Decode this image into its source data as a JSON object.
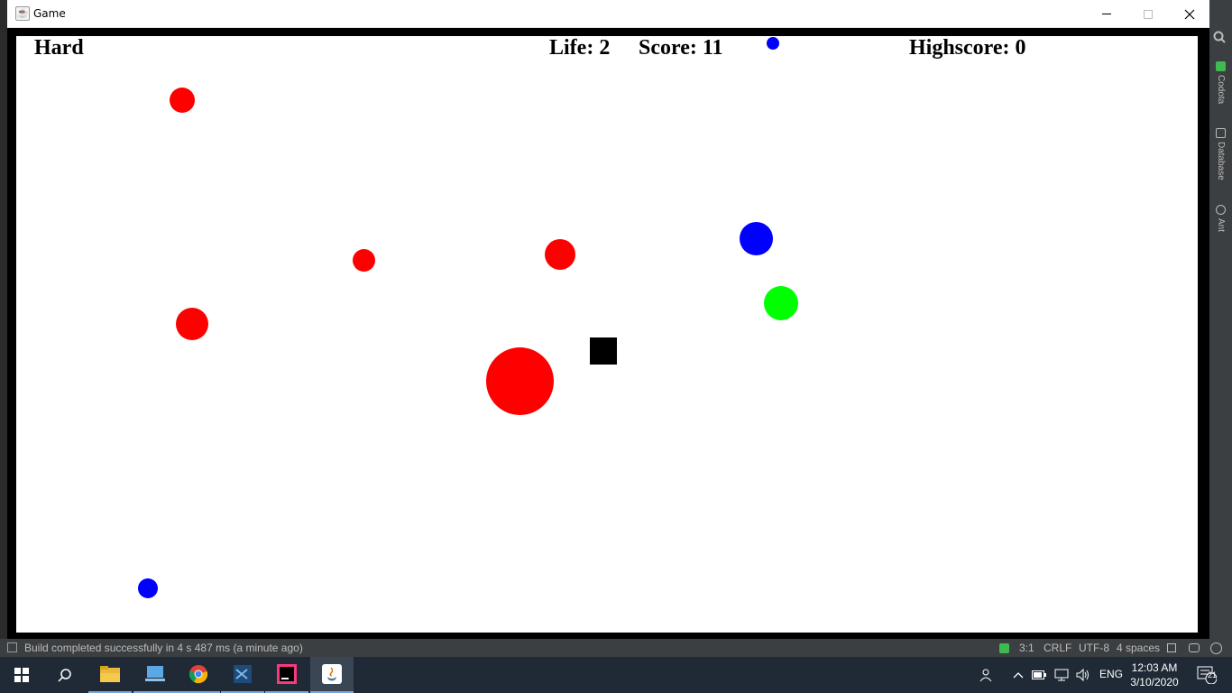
{
  "window": {
    "title": "Game",
    "controls": [
      "minimize",
      "maximize",
      "close"
    ]
  },
  "hud": {
    "difficulty": "Hard",
    "life": "Life: 2",
    "score": "Score: 11",
    "highscore": "Highscore: 0"
  },
  "game_objects": {
    "colors": {
      "red": "#ff0000",
      "blue": "#0000ff",
      "green": "#00ff00",
      "player": "#000000",
      "background": "#ffffff",
      "frame": "#000000"
    },
    "balls": [
      {
        "color": "blue",
        "kind": "small"
      },
      {
        "color": "red",
        "kind": "small"
      },
      {
        "color": "red",
        "kind": "small"
      },
      {
        "color": "red",
        "kind": "medium"
      },
      {
        "color": "blue",
        "kind": "medium"
      },
      {
        "color": "green",
        "kind": "medium"
      },
      {
        "color": "red",
        "kind": "medium"
      },
      {
        "color": "red",
        "kind": "large"
      },
      {
        "color": "blue",
        "kind": "small"
      }
    ],
    "player": "square"
  },
  "ide": {
    "side_tools": [
      "Codota",
      "Database",
      "Ant"
    ],
    "status_message": "Build completed successfully in 4 s 487 ms (a minute ago)",
    "status_right": [
      "3:1",
      "CRLF",
      "UTF-8",
      "4 spaces"
    ]
  },
  "taskbar": {
    "apps": [
      "start-icon",
      "search-icon",
      "file-explorer-icon",
      "pc-icon",
      "chrome-icon",
      "vscode-icon",
      "intellij-icon",
      "java-icon"
    ],
    "language": "ENG",
    "time": "12:03 AM",
    "date": "3/10/2020",
    "notifications": "21"
  }
}
